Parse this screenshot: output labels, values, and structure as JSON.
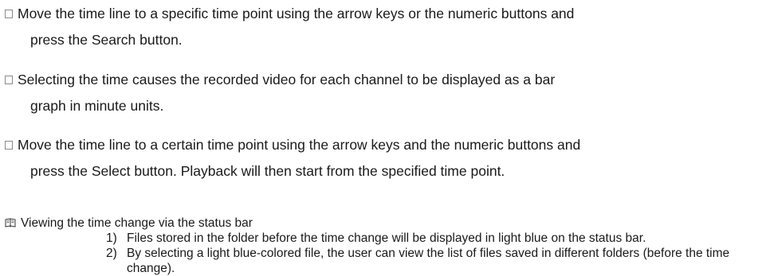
{
  "bullets": [
    {
      "line1": "Move the time line to a specific time point using the arrow keys or the numeric buttons and",
      "line2": "press the Search button."
    },
    {
      "line1": "Selecting the time causes the recorded video for each channel to be displayed as a bar",
      "line2": "graph in minute units."
    },
    {
      "line1": "Move the time line to a certain time point using the arrow keys and the numeric buttons and",
      "line2": "press the Select button. Playback will then start from the specified time point."
    }
  ],
  "note": {
    "icon": "book-icon",
    "title": "Viewing the time change via the status bar",
    "items": [
      {
        "num": "1)",
        "text": "Files stored in the folder before the time change will be displayed in light blue on the status bar."
      },
      {
        "num": "2)",
        "text": "By selecting a light blue-colored file, the user can view the list of files saved in different folders (before the time change)."
      }
    ]
  }
}
